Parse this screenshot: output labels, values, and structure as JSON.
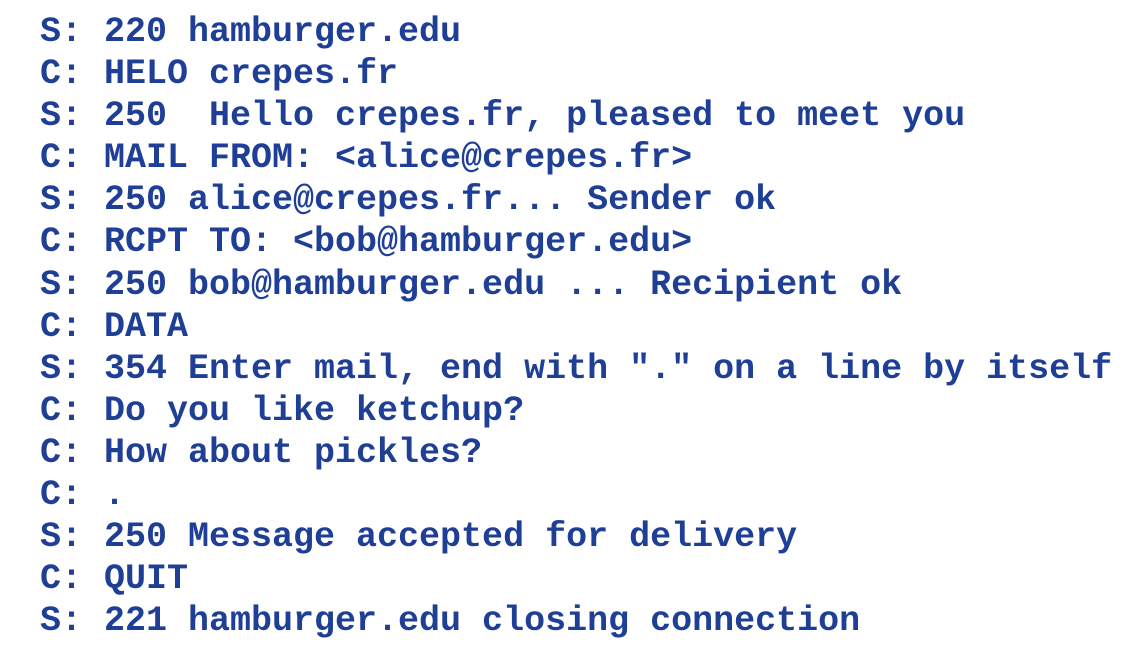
{
  "transcript": {
    "color": "#1f3f97",
    "lines": [
      {
        "who": "S:",
        "text": "220 hamburger.edu"
      },
      {
        "who": "C:",
        "text": "HELO crepes.fr"
      },
      {
        "who": "S:",
        "text": "250  Hello crepes.fr, pleased to meet you"
      },
      {
        "who": "C:",
        "text": "MAIL FROM: <alice@crepes.fr>"
      },
      {
        "who": "S:",
        "text": "250 alice@crepes.fr... Sender ok"
      },
      {
        "who": "C:",
        "text": "RCPT TO: <bob@hamburger.edu>"
      },
      {
        "who": "S:",
        "text": "250 bob@hamburger.edu ... Recipient ok"
      },
      {
        "who": "C:",
        "text": "DATA"
      },
      {
        "who": "S:",
        "text": "354 Enter mail, end with \".\" on a line by itself"
      },
      {
        "who": "C:",
        "text": "Do you like ketchup?"
      },
      {
        "who": "C:",
        "text": "How about pickles?"
      },
      {
        "who": "C:",
        "text": "."
      },
      {
        "who": "S:",
        "text": "250 Message accepted for delivery"
      },
      {
        "who": "C:",
        "text": "QUIT"
      },
      {
        "who": "S:",
        "text": "221 hamburger.edu closing connection"
      }
    ]
  }
}
